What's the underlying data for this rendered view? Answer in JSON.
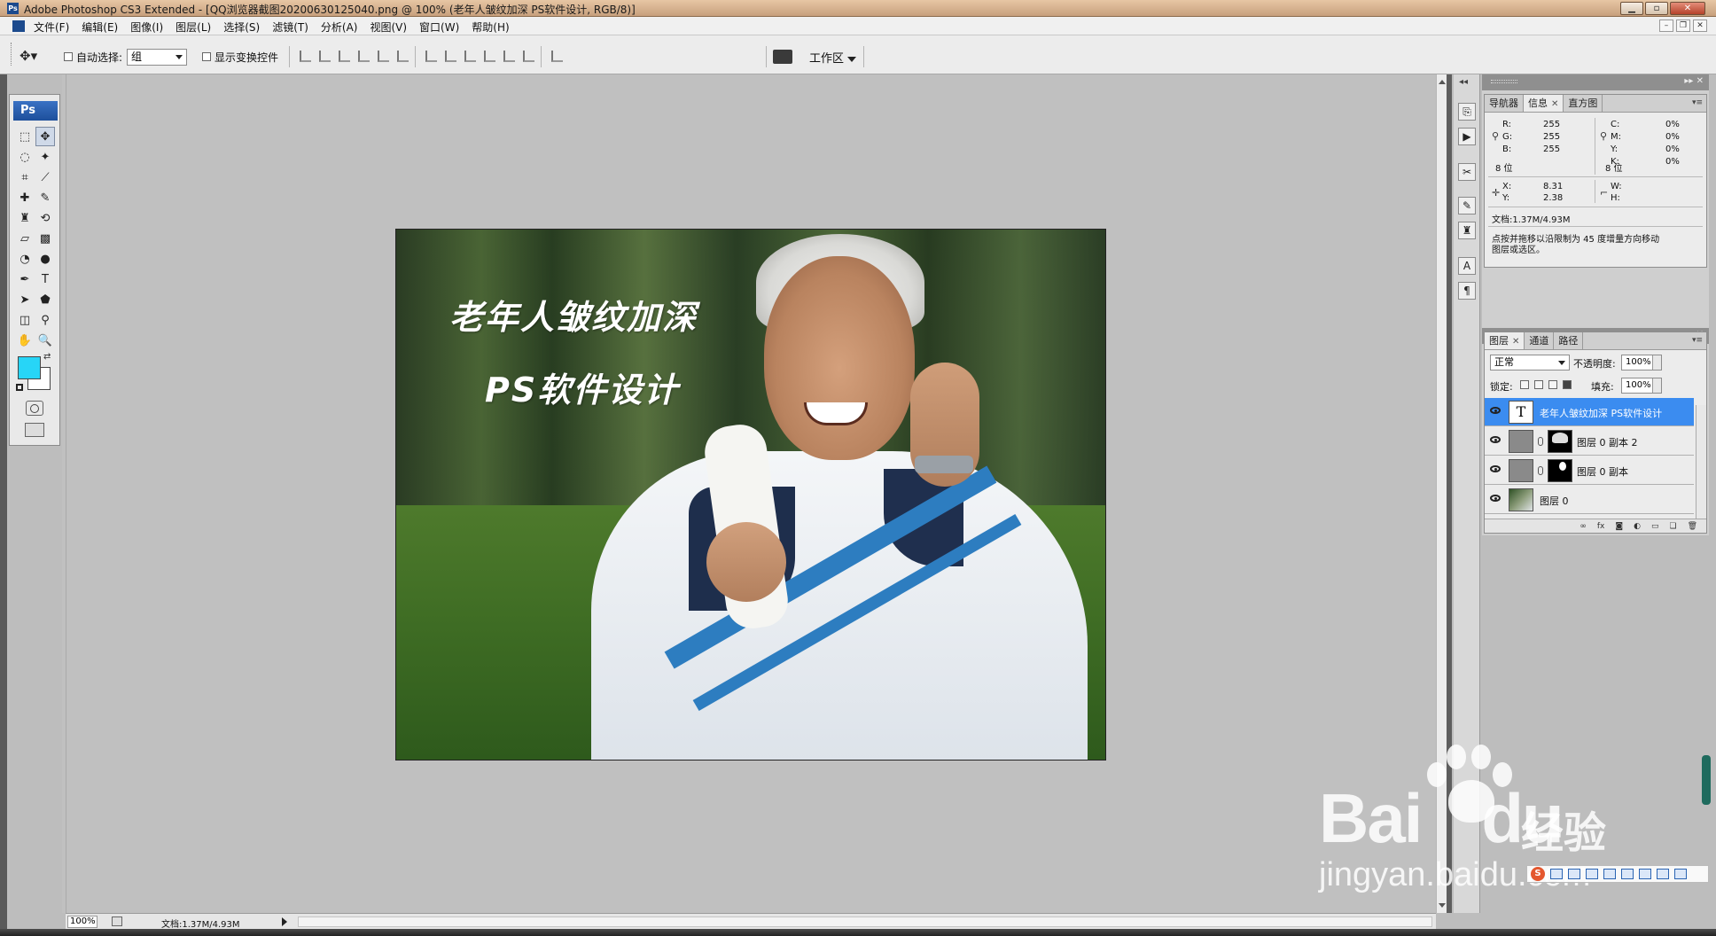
{
  "window": {
    "title": "Adobe Photoshop CS3 Extended - [QQ浏览器截图20200630125040.png @ 100% (老年人皱纹加深  PS软件设计, RGB/8)]",
    "app_icon_text": "Ps",
    "buttons": [
      "minimize",
      "maximize",
      "close"
    ]
  },
  "menubar": {
    "items": [
      "文件(F)",
      "编辑(E)",
      "图像(I)",
      "图层(L)",
      "选择(S)",
      "滤镜(T)",
      "分析(A)",
      "视图(V)",
      "窗口(W)",
      "帮助(H)"
    ]
  },
  "options": {
    "auto_select_label": "自动选择:",
    "auto_select_value": "组",
    "show_transform_label": "显示变换控件",
    "workspace_label": "工作区"
  },
  "toolbox": {
    "logo": "Ps",
    "foreground_color": "#27d5f7",
    "background_color": "#ffffff",
    "tools": [
      "marquee-icon",
      "move-icon",
      "lasso-icon",
      "magic-wand-icon",
      "crop-icon",
      "slice-icon",
      "healing-icon",
      "brush-icon",
      "stamp-icon",
      "history-brush-icon",
      "eraser-icon",
      "gradient-icon",
      "blur-icon",
      "dodge-icon",
      "pen-icon",
      "type-icon",
      "path-select-icon",
      "shape-icon",
      "notes-icon",
      "eyedropper-icon",
      "hand-icon",
      "zoom-icon"
    ]
  },
  "canvas": {
    "overlay_title": "老年人皱纹加深",
    "overlay_subtitle": "PS软件设计"
  },
  "status": {
    "zoom": "100%",
    "doc_info": "文档:1.37M/4.93M"
  },
  "info_panel": {
    "tabs": [
      "导航器",
      "信息",
      "直方图"
    ],
    "active_tab": "信息",
    "r_label": "R:",
    "r_value": "255",
    "g_label": "G:",
    "g_value": "255",
    "b_label": "B:",
    "b_value": "255",
    "c_label": "C:",
    "c_value": "0%",
    "m_label": "M:",
    "m_value": "0%",
    "y_label": "Y:",
    "y_value": "0%",
    "k_label": "K:",
    "k_value": "0%",
    "bit_left": "8 位",
    "bit_right": "8 位",
    "x_label": "X:",
    "x_value": "8.31",
    "yc_label": "Y:",
    "yc_value": "2.38",
    "w_label": "W:",
    "h_label": "H:",
    "doc_info": "文档:1.37M/4.93M",
    "hint_line1": "点按并拖移以沿限制为 45 度增量方向移动",
    "hint_line2": "图层或选区。"
  },
  "layers_panel": {
    "tabs": [
      "图层",
      "通道",
      "路径"
    ],
    "active_tab": "图层",
    "blend_mode": "正常",
    "opacity_label": "不透明度:",
    "opacity_value": "100%",
    "lock_label": "锁定:",
    "fill_label": "填充:",
    "fill_value": "100%",
    "layers": [
      {
        "name": "老年人皱纹加深  PS软件设计",
        "kind": "text",
        "selected": true
      },
      {
        "name": "图层 0 副本 2",
        "kind": "masked",
        "selected": false
      },
      {
        "name": "图层 0 副本",
        "kind": "masked",
        "selected": false
      },
      {
        "name": "图层 0",
        "kind": "photo",
        "selected": false
      }
    ]
  },
  "watermark": {
    "brand": "Bai",
    "brand_du": "du",
    "brand_cn": "经验",
    "url": "jingyan.baidu.com"
  },
  "ime": {
    "logo": "S"
  }
}
